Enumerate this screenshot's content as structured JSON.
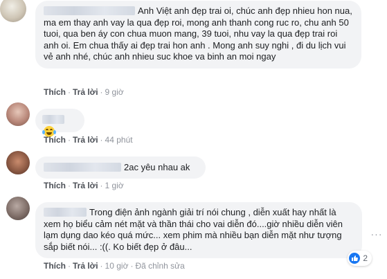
{
  "comments": [
    {
      "text": "Anh Việt anh đẹp trai oi, chúc anh đẹp nhieu hon nua, ma em thay anh vay la qua đẹp roi, mong anh thanh cong ruc ro, chu anh 50 tuoi, qua ben áy con chua muon mang, 39 tuoi, nhu vay la qua đẹp trai roi anh oi. Em chua thấy ai đẹp trai hon anh . Mong anh suy nghi , đi du lịch vui vẻ anh nhé, chúc anh nhieu suc khoe va binh an moi ngay",
      "like": "Thích",
      "reply": "Trả lời",
      "time": "9 giờ"
    },
    {
      "text": "",
      "emoji": "laughing-tears",
      "like": "Thích",
      "reply": "Trả lời",
      "time": "44 phút"
    },
    {
      "text": "2ac yêu nhau ak",
      "like": "Thích",
      "reply": "Trả lời",
      "time": "1 giờ"
    },
    {
      "text": "Trong điện ảnh ngành giải trí nói chung , diễn xuất hay nhất là xem họ biểu cảm nét mặt và thần thái cho vai diễn đó....giờ nhiều diễn viên lạm dụng dao kéo quá mức... xem phim mà nhiều bạn diễn mặt như tượng sắp biết nói... :((. Ko biết đẹp ở đâu...",
      "like": "Thích",
      "reply": "Trả lời",
      "time": "10 giờ",
      "edited": "Đã chỉnh sửa",
      "reaction_count": "2"
    }
  ],
  "colors": {
    "bubble": "#f2f3f5",
    "link": "#4b4f56",
    "like_blue": "#1877f2"
  }
}
